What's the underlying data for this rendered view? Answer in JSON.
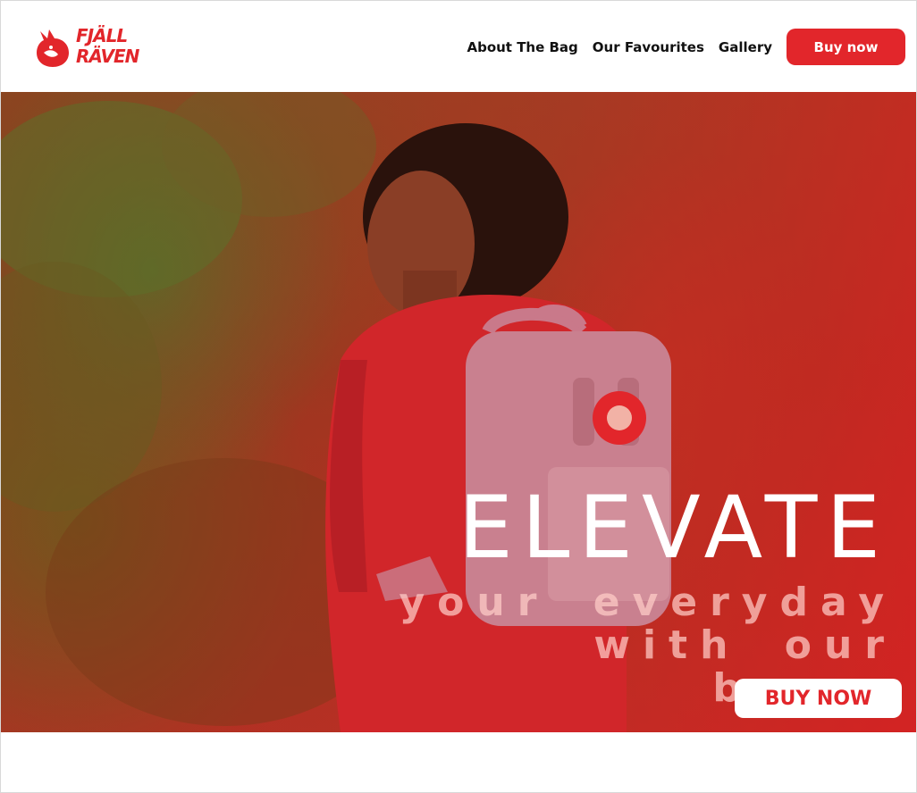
{
  "brand": {
    "logo_line1": "FJÄLL",
    "logo_line2": "RÄVEN",
    "accent_color": "#e2262b"
  },
  "nav": {
    "items": [
      {
        "label": "About The Bag"
      },
      {
        "label": "Our Favourites"
      },
      {
        "label": "Gallery"
      }
    ],
    "buy_label": "Buy now"
  },
  "hero": {
    "headline": "ELEVATE",
    "subline_1": "your everyday",
    "subline_2": "with our bags.",
    "cta_label": "BUY NOW",
    "overlay_color": "#e2262b"
  },
  "icons": [
    "fox-logo-icon",
    "backpack-logo-badge-icon"
  ]
}
